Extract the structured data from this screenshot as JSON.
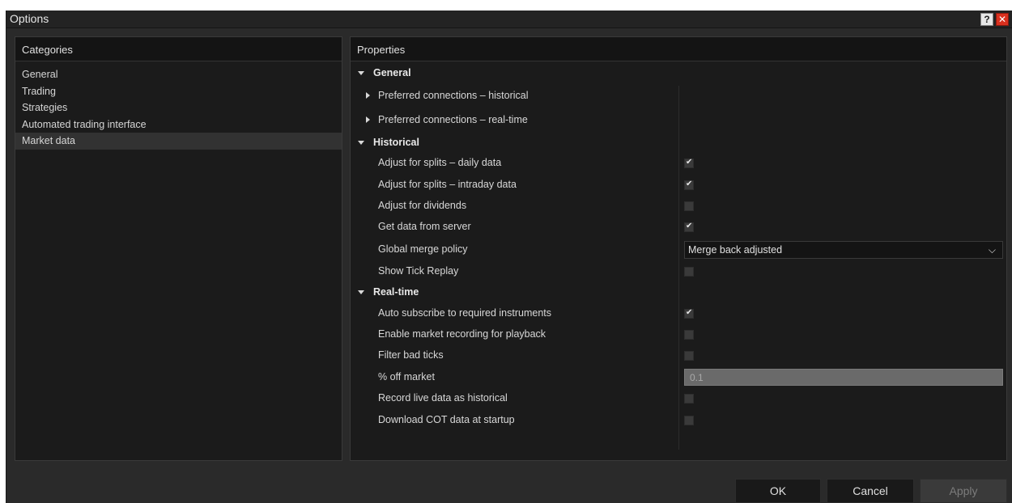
{
  "window": {
    "title": "Options",
    "help_label": "?",
    "close_label": "✕"
  },
  "categories": {
    "header": "Categories",
    "items": [
      {
        "label": "General"
      },
      {
        "label": "Trading"
      },
      {
        "label": "Strategies"
      },
      {
        "label": "Automated trading interface"
      },
      {
        "label": "Market data",
        "selected": true
      }
    ]
  },
  "properties": {
    "header": "Properties",
    "general": {
      "label": "General",
      "historical_conn": "Preferred connections – historical",
      "realtime_conn": "Preferred connections – real-time"
    },
    "historical": {
      "label": "Historical",
      "adjust_splits_daily": {
        "label": "Adjust for splits – daily data",
        "checked": true
      },
      "adjust_splits_intraday": {
        "label": "Adjust for splits – intraday data",
        "checked": true
      },
      "adjust_dividends": {
        "label": "Adjust for dividends",
        "checked": false
      },
      "get_data_server": {
        "label": "Get data from server",
        "checked": true
      },
      "merge_policy": {
        "label": "Global merge policy",
        "value": "Merge back adjusted"
      },
      "show_tick_replay": {
        "label": "Show Tick Replay",
        "checked": false
      }
    },
    "realtime": {
      "label": "Real-time",
      "auto_subscribe": {
        "label": "Auto subscribe to required instruments",
        "checked": true
      },
      "market_recording": {
        "label": "Enable market recording for playback",
        "checked": false
      },
      "filter_bad_ticks": {
        "label": "Filter bad ticks",
        "checked": false
      },
      "off_market": {
        "label": "% off market",
        "value": "0.1"
      },
      "record_live": {
        "label": "Record live data as historical",
        "checked": false
      },
      "download_cot": {
        "label": "Download COT data at startup",
        "checked": false
      }
    }
  },
  "buttons": {
    "ok": "OK",
    "cancel": "Cancel",
    "apply": "Apply"
  }
}
